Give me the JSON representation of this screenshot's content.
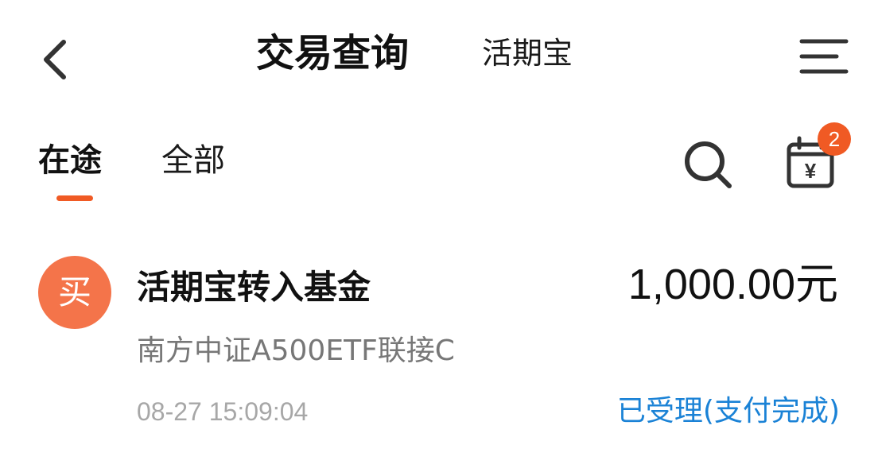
{
  "header": {
    "title": "交易查询",
    "subtitle": "活期宝"
  },
  "icons": {
    "back": "chevron-left-icon",
    "menu": "menu-lines-icon",
    "search": "search-icon",
    "calendar": "calendar-yuan-icon"
  },
  "tabs": [
    {
      "label": "在途",
      "active": true
    },
    {
      "label": "全部",
      "active": false
    }
  ],
  "calendar_badge": "2",
  "record": {
    "avatar_label": "买",
    "title": "活期宝转入基金",
    "amount": "1,000.00元",
    "fund_name": "南方中证A500ETF联接C",
    "time": "08-27 15:09:04",
    "status": "已受理(支付完成)"
  },
  "colors": {
    "accent": "#f05a24",
    "avatar_bg": "#f4744a",
    "status_blue": "#1a82d6",
    "secondary_text": "#777777",
    "tertiary_text": "#a7a7a7"
  }
}
